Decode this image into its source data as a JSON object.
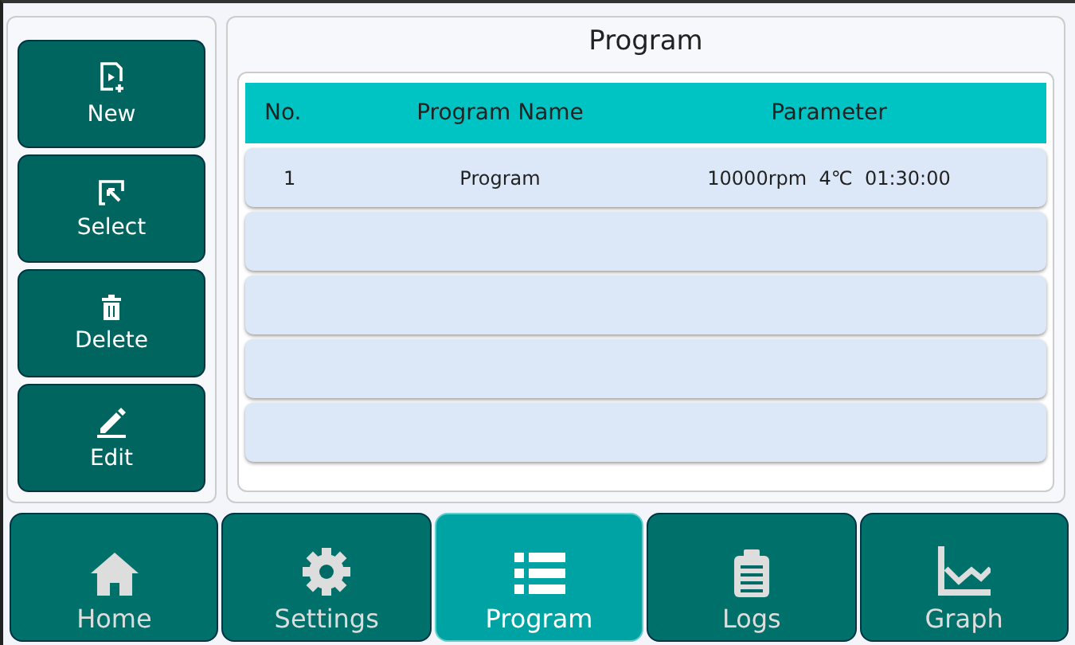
{
  "side_buttons": [
    {
      "kind": "new",
      "label": "New"
    },
    {
      "kind": "select",
      "label": "Select"
    },
    {
      "kind": "delete",
      "label": "Delete"
    },
    {
      "kind": "edit",
      "label": "Edit"
    }
  ],
  "panel": {
    "title": "Program"
  },
  "table": {
    "columns": [
      "No.",
      "Program Name",
      "Parameter"
    ],
    "rows": [
      {
        "no": "1",
        "name": "Program",
        "parameter": "10000rpm  4℃  01:30:00"
      },
      {},
      {},
      {},
      {}
    ]
  },
  "nav": [
    {
      "kind": "home",
      "label": "Home",
      "selected": false
    },
    {
      "kind": "settings",
      "label": "Settings",
      "selected": false
    },
    {
      "kind": "program",
      "label": "Program",
      "selected": true
    },
    {
      "kind": "logs",
      "label": "Logs",
      "selected": false
    },
    {
      "kind": "graph",
      "label": "Graph",
      "selected": false
    }
  ]
}
